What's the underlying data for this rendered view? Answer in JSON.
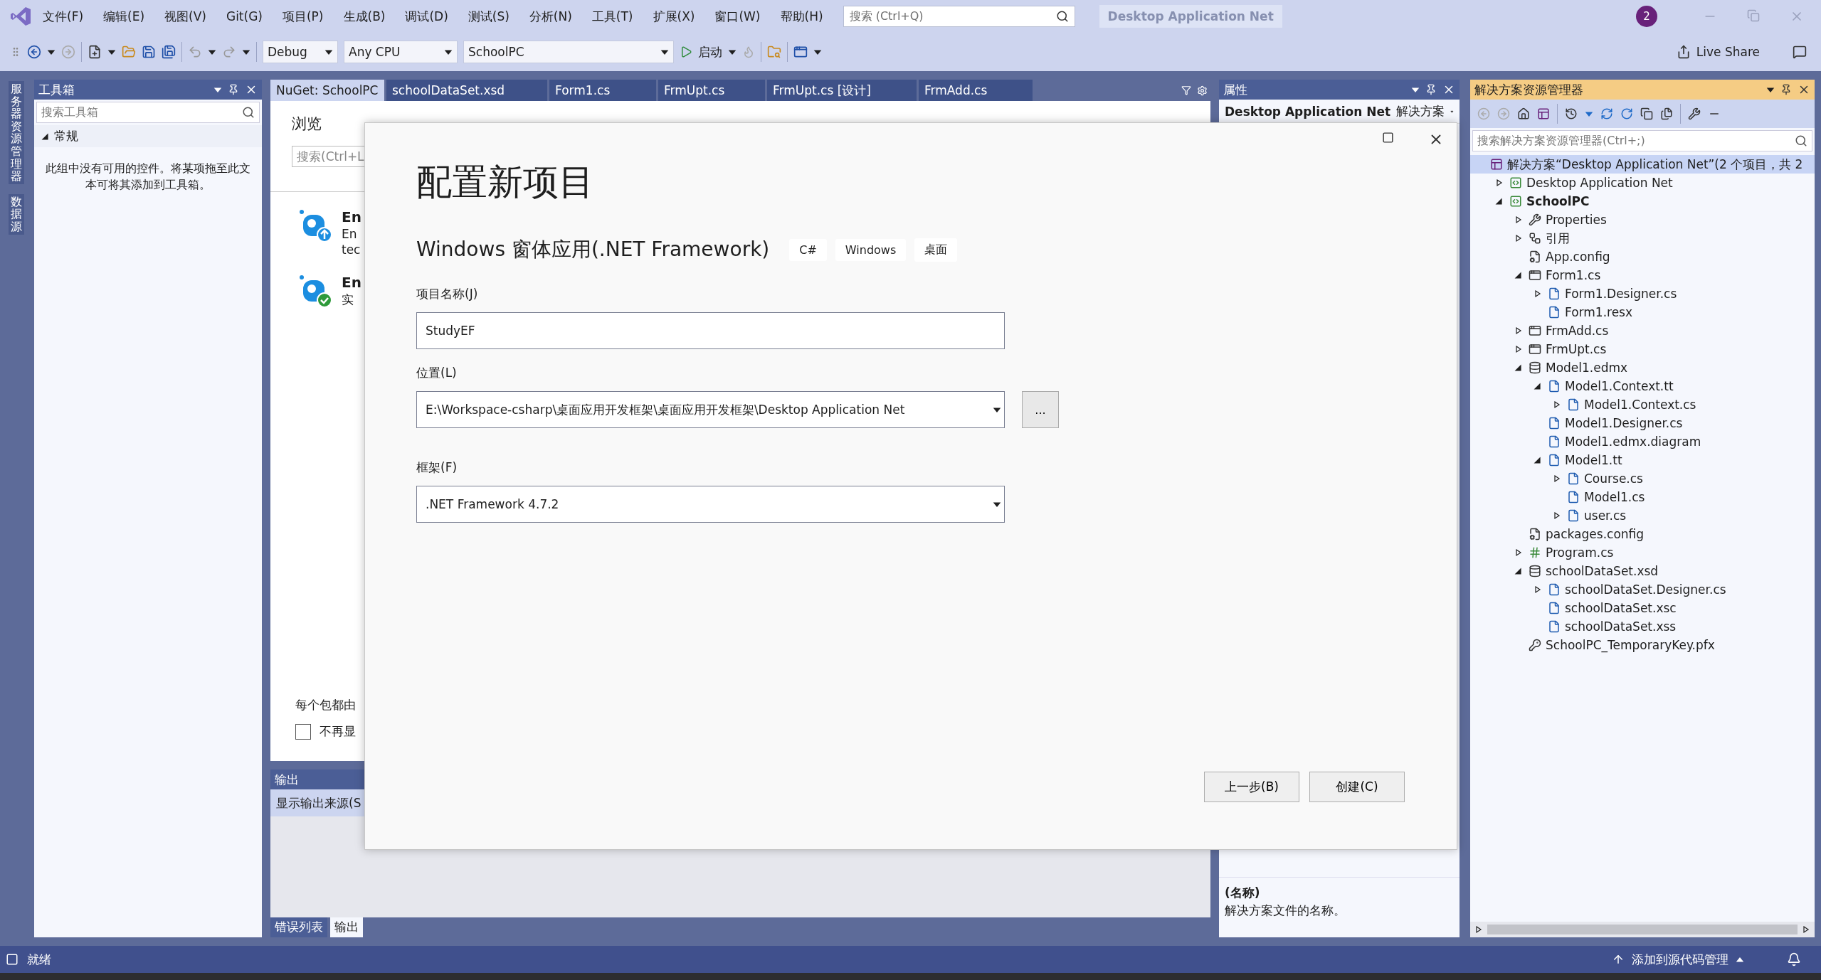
{
  "title_bar": {
    "menus": [
      "文件(F)",
      "编辑(E)",
      "视图(V)",
      "Git(G)",
      "项目(P)",
      "生成(B)",
      "调试(D)",
      "测试(S)",
      "分析(N)",
      "工具(T)",
      "扩展(X)",
      "窗口(W)",
      "帮助(H)"
    ],
    "search": {
      "placeholder": "搜索 (Ctrl+Q)"
    },
    "solution_name": "Desktop Application Net",
    "account_badge": "2"
  },
  "toolbar": {
    "configuration": "Debug",
    "platform": "Any CPU",
    "startup_project": "SchoolPC",
    "start_label": "启动",
    "live_share": "Live Share"
  },
  "side_tabs": [
    "服务器资源管理器",
    "数据源"
  ],
  "toolbox": {
    "title": "工具箱",
    "search": {
      "placeholder": "搜索工具箱"
    },
    "group": {
      "label": "常规",
      "expanded": true
    },
    "empty_message": "此组中没有可用的控件。将某项拖至此文本可将其添加到工具箱。"
  },
  "document_tabs": [
    {
      "label": "NuGet: SchoolPC",
      "selected": true
    },
    {
      "label": "schoolDataSet.xsd",
      "selected": false
    },
    {
      "label": "Form1.cs",
      "selected": false
    },
    {
      "label": "FrmUpt.cs",
      "selected": false
    },
    {
      "label": "FrmUpt.cs [设计]",
      "selected": false
    },
    {
      "label": "FrmAdd.cs",
      "selected": false
    }
  ],
  "nuget": {
    "browse_tab": "浏览",
    "search": {
      "placeholder": "搜索(Ctrl+L"
    },
    "packages": [
      {
        "kind": "update",
        "title": "En",
        "lines": [
          "En",
          "tec"
        ]
      },
      {
        "kind": "installed",
        "title": "En",
        "lines": [
          "实"
        ]
      }
    ],
    "notice": "每个包都由",
    "dont_show": {
      "label": "不再显",
      "checked": false
    }
  },
  "output": {
    "title": "输出",
    "source_label": "显示输出来源(S"
  },
  "bottom_tabs": [
    {
      "label": "错误列表",
      "selected": false
    },
    {
      "label": "输出",
      "selected": true
    }
  ],
  "properties": {
    "title": "属性",
    "object": "Desktop Application Net",
    "object_type": "解决方案",
    "description_title": "(名称)",
    "description": "解决方案文件的名称。"
  },
  "solution_explorer": {
    "title": "解决方案资源管理器",
    "search": {
      "placeholder": "搜索解决方案资源管理器(Ctrl+;)"
    },
    "tree": [
      {
        "label": "解决方案“Desktop Application Net”(2 个项目，共 2",
        "kind": "solution",
        "selected": true,
        "children": [
          {
            "label": "Desktop Application Net",
            "kind": "project",
            "expanded": false,
            "selected": false
          },
          {
            "label": "SchoolPC",
            "kind": "project",
            "expanded": true,
            "selected": false,
            "startup": true,
            "children": [
              {
                "label": "Properties",
                "kind": "wrench",
                "expanded": false,
                "selected": false
              },
              {
                "label": "引用",
                "kind": "references",
                "expanded": false,
                "selected": false
              },
              {
                "label": "App.config",
                "kind": "config",
                "selected": false
              },
              {
                "label": "Form1.cs",
                "kind": "form",
                "expanded": true,
                "selected": false,
                "children": [
                  {
                    "label": "Form1.Designer.cs",
                    "kind": "file",
                    "expanded": false,
                    "selected": false
                  },
                  {
                    "label": "Form1.resx",
                    "kind": "file",
                    "selected": false
                  }
                ]
              },
              {
                "label": "FrmAdd.cs",
                "kind": "form",
                "expanded": false,
                "selected": false
              },
              {
                "label": "FrmUpt.cs",
                "kind": "form",
                "expanded": false,
                "selected": false
              },
              {
                "label": "Model1.edmx",
                "kind": "model",
                "expanded": true,
                "selected": false,
                "children": [
                  {
                    "label": "Model1.Context.tt",
                    "kind": "file",
                    "expanded": true,
                    "selected": false,
                    "children": [
                      {
                        "label": "Model1.Context.cs",
                        "kind": "file",
                        "expanded": false,
                        "selected": false
                      }
                    ]
                  },
                  {
                    "label": "Model1.Designer.cs",
                    "kind": "file",
                    "selected": false
                  },
                  {
                    "label": "Model1.edmx.diagram",
                    "kind": "file",
                    "selected": false
                  },
                  {
                    "label": "Model1.tt",
                    "kind": "file",
                    "expanded": true,
                    "selected": false,
                    "children": [
                      {
                        "label": "Course.cs",
                        "kind": "file",
                        "expanded": false,
                        "selected": false
                      },
                      {
                        "label": "Model1.cs",
                        "kind": "file",
                        "selected": false
                      },
                      {
                        "label": "user.cs",
                        "kind": "file",
                        "expanded": false,
                        "selected": false
                      }
                    ]
                  }
                ]
              },
              {
                "label": "packages.config",
                "kind": "config",
                "selected": false
              },
              {
                "label": "Program.cs",
                "kind": "csharp",
                "expanded": false,
                "selected": false
              },
              {
                "label": "schoolDataSet.xsd",
                "kind": "dataset",
                "expanded": true,
                "selected": false,
                "children": [
                  {
                    "label": "schoolDataSet.Designer.cs",
                    "kind": "file",
                    "expanded": false,
                    "selected": false
                  },
                  {
                    "label": "schoolDataSet.xsc",
                    "kind": "file",
                    "selected": false
                  },
                  {
                    "label": "schoolDataSet.xss",
                    "kind": "file",
                    "selected": false
                  }
                ]
              },
              {
                "label": "SchoolPC_TemporaryKey.pfx",
                "kind": "key",
                "selected": false
              }
            ]
          }
        ]
      }
    ]
  },
  "dialog": {
    "title": "配置新项目",
    "template": "Windows 窗体应用(.NET Framework)",
    "tags": [
      "C#",
      "Windows",
      "桌面"
    ],
    "fields": [
      {
        "kind": "text",
        "label": "项目名称(J)",
        "value": "StudyEF"
      },
      {
        "kind": "browse",
        "label": "位置(L)",
        "value": "E:\\Workspace-csharp\\桌面应用开发框架\\桌面应用开发框架\\Desktop Application Net",
        "button": "..."
      },
      {
        "kind": "select",
        "label": "框架(F)",
        "value": ".NET Framework 4.7.2"
      }
    ],
    "buttons": [
      "上一步(B)",
      "创建(C)"
    ]
  },
  "status_bar": {
    "status": "就绪",
    "source_control": "添加到源代码管理"
  }
}
